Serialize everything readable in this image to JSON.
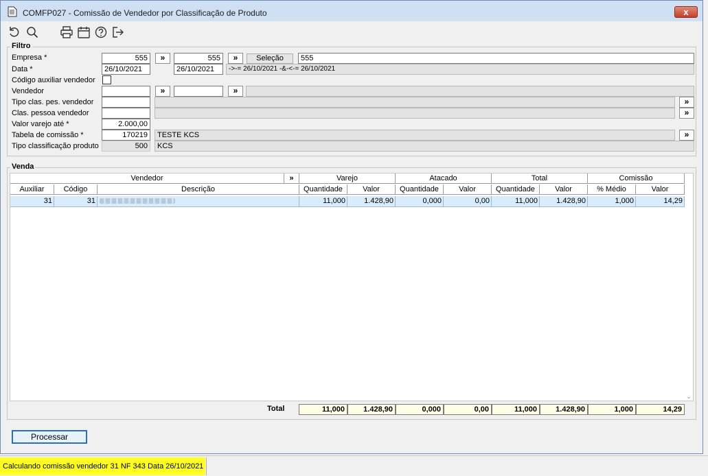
{
  "window": {
    "title": "COMFP027 - Comissão de Vendedor por Classificação de Produto",
    "close_label": "x"
  },
  "toolbar": {
    "icons": [
      "undo-icon",
      "search-icon",
      "print-icon",
      "calendar-icon",
      "help-icon",
      "exit-icon"
    ]
  },
  "filtro": {
    "title": "Filtro",
    "empresa": {
      "label": "Empresa *",
      "from": "555",
      "to": "555",
      "selecao_label": "Seleção",
      "selecao_value": "555"
    },
    "data": {
      "label": "Data *",
      "from": "26/10/2021",
      "to": "26/10/2021",
      "expression": "->-= 26/10/2021 -&-<-= 26/10/2021"
    },
    "codigo_aux": {
      "label": "Código auxiliar vendedor"
    },
    "vendedor": {
      "label": "Vendedor",
      "from": "",
      "to": "",
      "desc": ""
    },
    "tipo_clas": {
      "label": "Tipo clas. pes. vendedor",
      "value": "",
      "desc": ""
    },
    "clas_pessoa": {
      "label": "Clas. pessoa vendedor",
      "value": "",
      "desc": ""
    },
    "valor_varejo": {
      "label": "Valor varejo até *",
      "value": "2.000,00"
    },
    "tabela": {
      "label": "Tabela de comissão *",
      "value": "170219",
      "desc": "TESTE KCS"
    },
    "tipo_classif": {
      "label": "Tipo classificação produto",
      "value": "500",
      "desc": "KCS"
    },
    "arrow_label": "»"
  },
  "venda": {
    "title": "Venda",
    "group_headers": {
      "vendedor": "Vendedor",
      "arrow": "»",
      "varejo": "Varejo",
      "atacado": "Atacado",
      "total": "Total",
      "comissao": "Comissão"
    },
    "columns": {
      "auxiliar": "Auxiliar",
      "codigo": "Código",
      "descricao": "Descrição",
      "varejo_qtd": "Quantidade",
      "varejo_val": "Valor",
      "atacado_qtd": "Quantidade",
      "atacado_val": "Valor",
      "total_qtd": "Quantidade",
      "total_val": "Valor",
      "com_pct": "% Médio",
      "com_val": "Valor"
    },
    "rows": [
      {
        "auxiliar": "31",
        "codigo": "31",
        "descricao": "",
        "varejo_qtd": "11,000",
        "varejo_val": "1.428,90",
        "atacado_qtd": "0,000",
        "atacado_val": "0,00",
        "total_qtd": "11,000",
        "total_val": "1.428,90",
        "com_pct": "1,000",
        "com_val": "14,29"
      }
    ],
    "total_label": "Total",
    "totals": {
      "varejo_qtd": "11,000",
      "varejo_val": "1.428,90",
      "atacado_qtd": "0,000",
      "atacado_val": "0,00",
      "total_qtd": "11,000",
      "total_val": "1.428,90",
      "com_pct": "1,000",
      "com_val": "14,29"
    }
  },
  "actions": {
    "processar_label": "Processar"
  },
  "status": {
    "text": "Calculando comissão vendedor 31 NF 343 Data 26/10/2021"
  }
}
